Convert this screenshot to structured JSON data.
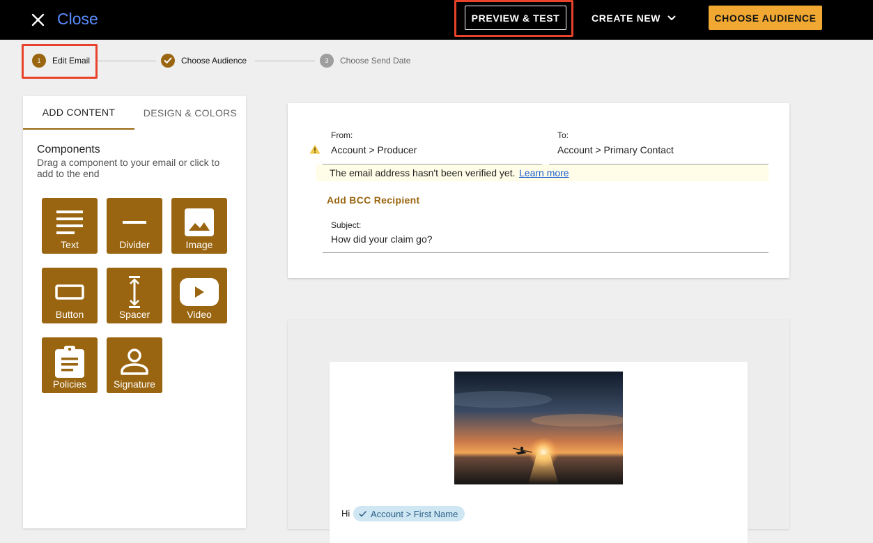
{
  "topbar": {
    "close_label": "Close",
    "preview_label": "PREVIEW & TEST",
    "create_label": "CREATE NEW",
    "audience_label": "CHOOSE AUDIENCE",
    "icons": {
      "close": "close-icon",
      "create": "chevron-down-icon"
    },
    "colors": {
      "background": "#000000",
      "close_link": "#5a8cff",
      "audience_button": "#f0a832",
      "highlight": "#e8432a"
    }
  },
  "stepper": {
    "steps": [
      {
        "number": "1",
        "label": "Edit Email",
        "state": "current"
      },
      {
        "number": "",
        "label": "Choose Audience",
        "state": "completed",
        "icon": "check-icon"
      },
      {
        "number": "3",
        "label": "Choose Send Date",
        "state": "upcoming"
      }
    ],
    "colors": {
      "active": "#9a6510",
      "inactive": "#9e9e9e"
    }
  },
  "sidebar": {
    "tabs": [
      {
        "label": "ADD CONTENT",
        "active": true
      },
      {
        "label": "DESIGN & COLORS",
        "active": false
      }
    ],
    "components_title": "Components",
    "components_desc": "Drag a component to your email or click to add to the end",
    "components": [
      {
        "label": "Text",
        "icon": "text-lines-icon"
      },
      {
        "label": "Divider",
        "icon": "divider-icon"
      },
      {
        "label": "Image",
        "icon": "image-icon"
      },
      {
        "label": "Button",
        "icon": "button-icon"
      },
      {
        "label": "Spacer",
        "icon": "spacer-icon"
      },
      {
        "label": "Video",
        "icon": "video-play-icon"
      },
      {
        "label": "Policies",
        "icon": "clipboard-icon"
      },
      {
        "label": "Signature",
        "icon": "person-icon"
      }
    ],
    "colors": {
      "tile": "#9a6510"
    }
  },
  "header": {
    "from_label": "From:",
    "from_value": "Account > Producer",
    "to_label": "To:",
    "to_value": "Account > Primary Contact",
    "warning_icon": "warning-triangle-icon",
    "warning_text": "The email address hasn't been verified yet.",
    "learn_more": "Learn more",
    "bcc_label": "Add BCC Recipient",
    "subject_label": "Subject:",
    "subject_value": "How did your claim go?",
    "colors": {
      "warning_bg": "#fffde7",
      "link": "#1a5fd1",
      "bcc": "#9a6510",
      "warning_icon": "#f2c94c"
    }
  },
  "email_body": {
    "image_icon": "sunset-kayak-photo",
    "greeting": "Hi",
    "merge_field": "Account > First Name",
    "merge_icon": "check-icon",
    "colors": {
      "chip_bg": "#cfe6f3",
      "chip_text": "#2b5f86"
    }
  }
}
